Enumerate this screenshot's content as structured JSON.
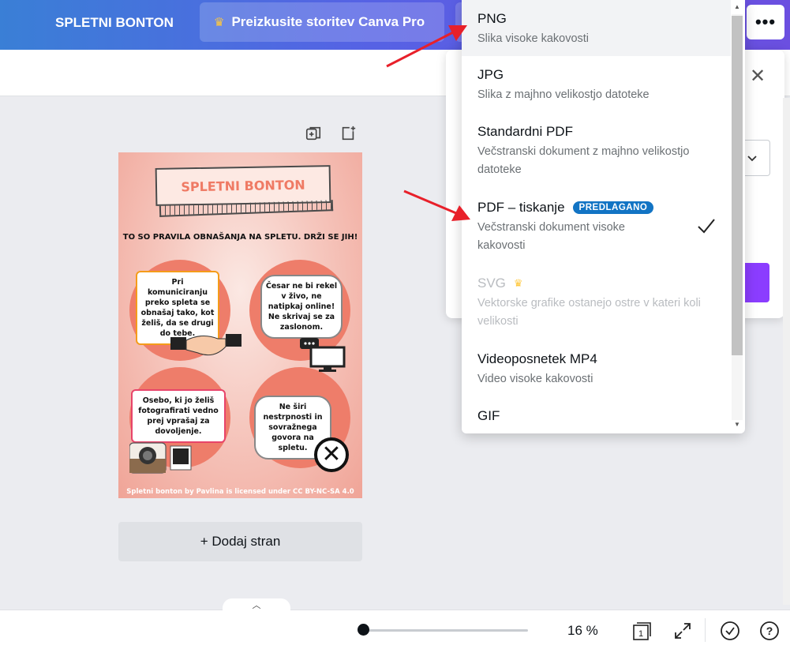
{
  "topbar": {
    "design_title": "SPLETNI BONTON",
    "pro_label": "Preizkusite storitev Canva Pro",
    "more_label": "•••"
  },
  "poster": {
    "title": "SPLETNI BONTON",
    "subtitle": "TO SO PRAVILA OBNAŠANJA NA SPLETU. DRŽI SE JIH!",
    "bubble1": "Pri komuniciranju preko spleta se obnašaj tako, kot želiš, da se drugi do tebe.",
    "bubble2": "Česar ne bi rekel v živo, ne natipkaj online! Ne skrivaj se za zaslonom.",
    "bubble3": "Osebo, ki jo želiš fotografirati vedno prej vprašaj za dovoljenje.",
    "bubble4": "Ne širi nestrpnosti in sovražnega govora na spletu.",
    "footer": "Spletni bonton by Pavlina is licensed under CC BY-NC-SA 4.0"
  },
  "canvas": {
    "add_page_label": "+ Dodaj stran"
  },
  "download_menu": {
    "options": [
      {
        "title": "PNG",
        "desc": "Slika visoke kakovosti"
      },
      {
        "title": "JPG",
        "desc": "Slika z majhno velikostjo datoteke"
      },
      {
        "title": "Standardni PDF",
        "desc": "Večstranski dokument z majhno velikostjo datoteke"
      },
      {
        "title": "PDF – tiskanje",
        "badge": "PREDLAGANO",
        "desc": "Večstranski dokument visoke kakovosti"
      },
      {
        "title": "SVG",
        "desc": "Vektorske grafike ostanejo ostre v kateri koli velikosti"
      },
      {
        "title": "Videoposnetek MP4",
        "desc": "Video visoke kakovosti"
      },
      {
        "title": "GIF",
        "desc": ""
      }
    ]
  },
  "bottombar": {
    "zoom": "16 %",
    "page_count": "1"
  },
  "colors": {
    "accent": "#8b3dff",
    "badge": "#1274c4",
    "arrow": "#e8202a"
  }
}
